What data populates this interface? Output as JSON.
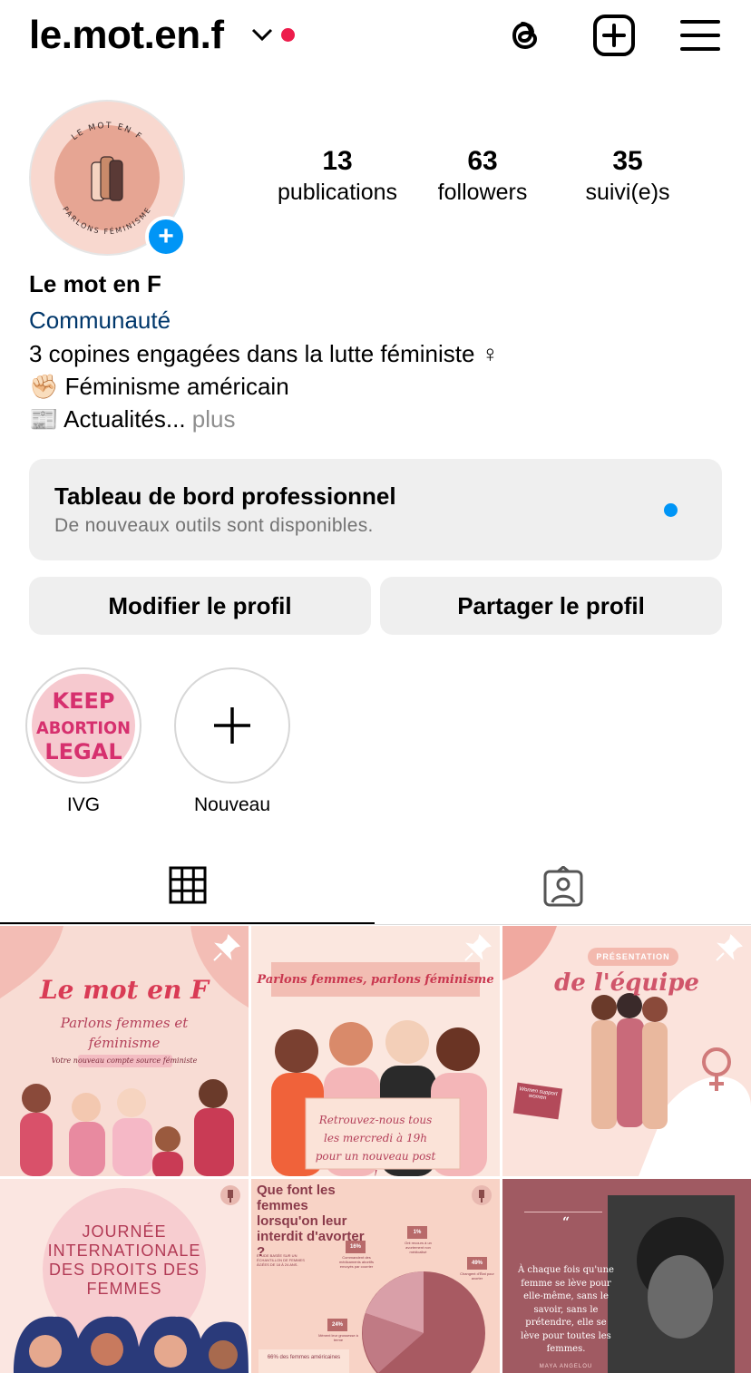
{
  "header": {
    "username": "le.mot.en.f",
    "icons": [
      "chevron-down-icon",
      "threads-icon",
      "create-post-icon",
      "menu-icon"
    ]
  },
  "profile": {
    "avatar_text_top": "LE MOT EN F",
    "avatar_text_bottom": "PARLONS FÉMINISME",
    "stats": [
      {
        "value": "13",
        "label": "publications"
      },
      {
        "value": "63",
        "label": "followers"
      },
      {
        "value": "35",
        "label": "suivi(e)s"
      }
    ],
    "name": "Le mot en F",
    "category": "Communauté",
    "bio": [
      "3 copines engagées dans la lutte féministe ♀",
      "✊🏻 Féminisme américain",
      "📰 Actualités..."
    ],
    "bio_more": "plus"
  },
  "dashboard": {
    "title": "Tableau de bord professionnel",
    "subtitle": "De nouveaux outils sont disponibles."
  },
  "actions": {
    "edit": "Modifier le profil",
    "share": "Partager le profil"
  },
  "highlights": [
    {
      "label": "IVG",
      "cover_text": [
        "KEEP",
        "ABORTION",
        "LEGAL"
      ]
    },
    {
      "label": "Nouveau"
    }
  ],
  "tabs": [
    "grid-icon",
    "tagged-icon"
  ],
  "colors": {
    "accent": "#0095f6",
    "link": "#00376b",
    "notif": "#ed1c4b",
    "grid_pink": "#f8d9d0",
    "plum": "#a05a62"
  },
  "posts": [
    {
      "title": "Le mot en F",
      "subtitle": "Parlons femmes et féminisme",
      "note": "Votre nouveau compte source féministe"
    },
    {
      "title": "Parlons femmes, parlons féminisme",
      "caption": "Retrouvez-nous tous les mercredi à 19h pour un nouveau post !"
    },
    {
      "badge": "PRÉSENTATION",
      "title": "de l'équipe",
      "sign": "Women support women"
    },
    {
      "title": "JOURNÉE INTERNATIONALE DES DROITS DES FEMMES"
    },
    {
      "title": "Que font les femmes lorsqu'on leur interdit d'avorter ?",
      "note": "ÉTUDE BASÉE SUR UN ÉCHANTILLON DE FEMMES ÂGÉES DE 18 À 24 ANS.",
      "stats": [
        "16%",
        "1%",
        "49%",
        "24%"
      ],
      "stat_labels": [
        "Commandent des médicaments abortifs envoyés par courrier",
        "Ont recours à un avortement non médicalisé",
        "Changent d'État pour avorter",
        "Mènent leur grossesse à terme"
      ],
      "footer": "66% des femmes américaines"
    },
    {
      "quote_mark": "“",
      "quote": "À chaque fois qu'une femme se lève pour elle-même, sans le savoir, sans le prétendre, elle se lève pour toutes les femmes.",
      "author": "MAYA ANGELOU"
    }
  ]
}
